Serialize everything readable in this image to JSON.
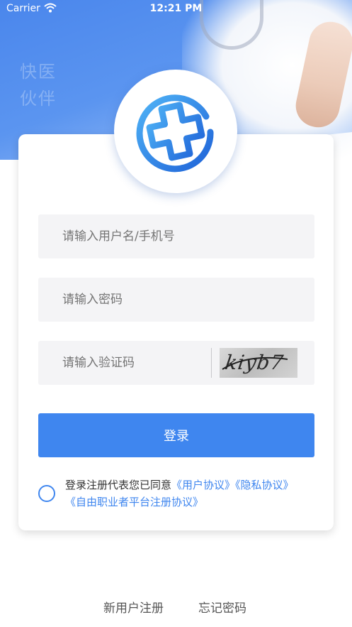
{
  "status_bar": {
    "carrier": "Carrier",
    "time": "12:21 PM"
  },
  "hero": {
    "slogan_line1": "快医",
    "slogan_line2": "伙伴"
  },
  "form": {
    "username_placeholder": "请输入用户名/手机号",
    "password_placeholder": "请输入密码",
    "code_placeholder": "请输入验证码",
    "captcha_text": "kiyb7",
    "login_label": "登录"
  },
  "agreement": {
    "prefix": "登录注册代表您已同意",
    "user_agreement": "《用户协议》",
    "privacy_agreement": "《隐私协议》",
    "freelancer_agreement": "《自由职业者平台注册协议》"
  },
  "footer": {
    "register_label": "新用户注册",
    "forgot_label": "忘记密码"
  },
  "colors": {
    "primary": "#3f86ef",
    "field_bg": "#f4f4f6"
  }
}
